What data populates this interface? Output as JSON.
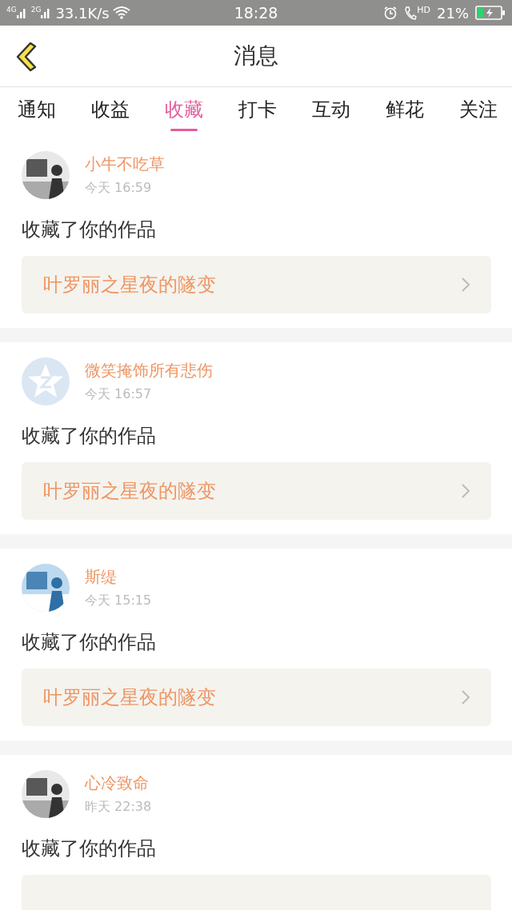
{
  "status_bar": {
    "network_1": "4G",
    "network_2": "2G",
    "speed": "33.1K/s",
    "time": "18:28",
    "call_badge": "HD",
    "battery": "21%"
  },
  "header": {
    "title": "消息"
  },
  "tabs": [
    {
      "label": "通知",
      "selected": false
    },
    {
      "label": "收益",
      "selected": false
    },
    {
      "label": "收藏",
      "selected": true
    },
    {
      "label": "打卡",
      "selected": false
    },
    {
      "label": "互动",
      "selected": false
    },
    {
      "label": "鲜花",
      "selected": false
    },
    {
      "label": "关注",
      "selected": false
    }
  ],
  "messages": [
    {
      "user": "小牛不吃草",
      "time": "今天 16:59",
      "action": "收藏了你的作品",
      "work": "叶罗丽之星夜的隧变"
    },
    {
      "avatar": {
        "kind": "default"
      },
      "user": "微笑掩饰所有悲伤",
      "time": "今天 16:57",
      "action": "收藏了你的作品",
      "work": "叶罗丽之星夜的隧变"
    },
    {
      "user": "斯缇",
      "time": "今天 15:15",
      "action": "收藏了你的作品",
      "work": "叶罗丽之星夜的隧变"
    },
    {
      "user": "心冷致命",
      "time": "昨天 22:38",
      "action": "收藏了你的作品"
    }
  ]
}
